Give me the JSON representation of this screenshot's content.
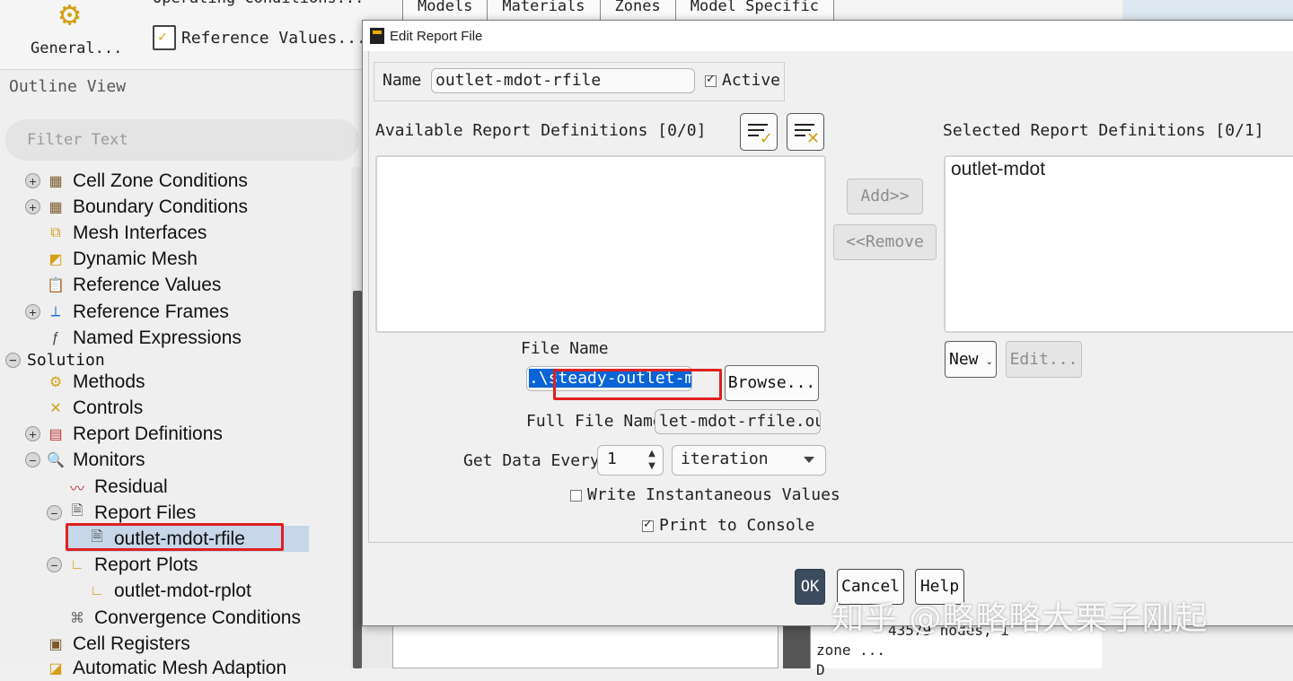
{
  "ribbon": {
    "general_label": "General...",
    "reference_values_label": "Reference Values...",
    "top_cut_label": "Operating Conditions...",
    "tabs": [
      "Models",
      "Materials",
      "Zones",
      "Model Specific"
    ]
  },
  "outline": {
    "title": "Outline View",
    "filter_placeholder": "Filter Text",
    "items": [
      {
        "label": "Cell Zone Conditions",
        "icon": "grid-icon",
        "expander": "plus"
      },
      {
        "label": "Boundary Conditions",
        "icon": "grid-icon",
        "expander": "plus"
      },
      {
        "label": "Mesh Interfaces",
        "icon": "mesh-interface-icon",
        "expander": "none"
      },
      {
        "label": "Dynamic Mesh",
        "icon": "dynamic-mesh-icon",
        "expander": "none"
      },
      {
        "label": "Reference Values",
        "icon": "clipboard-icon",
        "expander": "none"
      },
      {
        "label": "Reference Frames",
        "icon": "axes-icon",
        "expander": "plus"
      },
      {
        "label": "Named Expressions",
        "icon": "function-icon",
        "expander": "none"
      },
      {
        "label": "Solution",
        "icon": "",
        "expander": "minus"
      },
      {
        "label": "Methods",
        "icon": "gears-icon",
        "expander": "none"
      },
      {
        "label": "Controls",
        "icon": "controls-icon",
        "expander": "none"
      },
      {
        "label": "Report Definitions",
        "icon": "report-definitions-icon",
        "expander": "plus"
      },
      {
        "label": "Monitors",
        "icon": "magnifier-icon",
        "expander": "minus"
      },
      {
        "label": "Residual",
        "icon": "residual-chart-icon",
        "expander": "none"
      },
      {
        "label": "Report Files",
        "icon": "report-file-icon",
        "expander": "minus"
      },
      {
        "label": "outlet-mdot-rfile",
        "icon": "report-file-icon",
        "expander": "none"
      },
      {
        "label": "Report Plots",
        "icon": "plot-icon",
        "expander": "minus"
      },
      {
        "label": "outlet-mdot-rplot",
        "icon": "plot-icon",
        "expander": "none"
      },
      {
        "label": "Convergence Conditions",
        "icon": "convergence-icon",
        "expander": "none"
      },
      {
        "label": "Cell Registers",
        "icon": "cell-registers-icon",
        "expander": "none"
      },
      {
        "label": "Automatic Mesh Adaption",
        "icon": "mesh-adaption-icon",
        "expander": "none"
      }
    ]
  },
  "dialog": {
    "title": "Edit Report File",
    "name_label": "Name",
    "name_value": "outlet-mdot-rfile",
    "active_label": "Active",
    "active_checked": true,
    "available_label": "Available Report Definitions [0/0]",
    "selected_label": "Selected Report Definitions [0/1]",
    "available_items": [],
    "selected_items": [
      "outlet-mdot"
    ],
    "add_label": "Add>>",
    "remove_label": "<<Remove",
    "new_label": "New",
    "edit_label": "Edit...",
    "file_name_label": "File Name",
    "file_name_prefix": ".\\",
    "file_name_value": "steady-outlet-m",
    "browse_label": "Browse...",
    "full_file_name_label": "Full File Name",
    "full_file_name_value": "let-mdot-rfile.out",
    "get_data_every_label": "Get Data Every",
    "get_data_every_value": "1",
    "get_data_unit": "iteration",
    "write_instantaneous_label": "Write Instantaneous Values",
    "write_instantaneous_checked": false,
    "print_console_label": "Print to Console",
    "print_console_checked": true,
    "ok_label": "OK",
    "cancel_label": "Cancel",
    "help_label": "Help"
  },
  "console": {
    "line1": "43579 nodes,   i",
    "line2": "zone  ...",
    "line3": "  D"
  },
  "watermark": "知乎 @略略略大栗子刚起",
  "colors": {
    "highlight_red": "#e02020",
    "selection_blue": "#0a64d6",
    "ok_button": "#3c4c5e"
  }
}
